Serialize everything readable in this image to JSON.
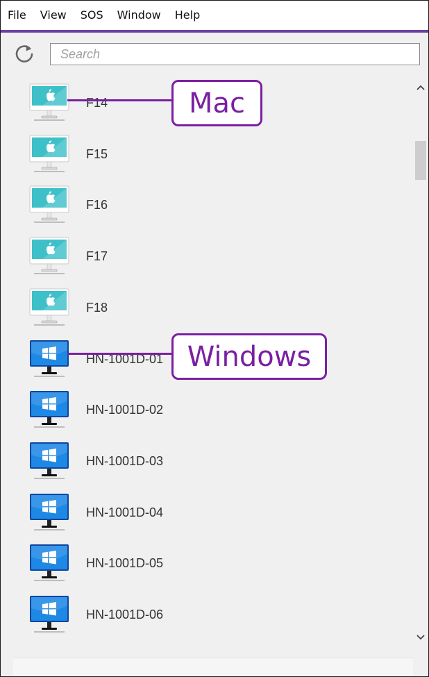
{
  "menu": {
    "items": [
      "File",
      "View",
      "SOS",
      "Window",
      "Help"
    ]
  },
  "toolbar": {
    "refresh_icon": "refresh-icon",
    "search_placeholder": "Search",
    "search_value": ""
  },
  "colors": {
    "accent": "#6b3fa0",
    "callout": "#7b1fa2",
    "mac_screen": "#3ec0c8",
    "windows_screen": "#1e88e5"
  },
  "computers": [
    {
      "name": "F14",
      "os": "mac",
      "icon": "mac-monitor-icon"
    },
    {
      "name": "F15",
      "os": "mac",
      "icon": "mac-monitor-icon"
    },
    {
      "name": "F16",
      "os": "mac",
      "icon": "mac-monitor-icon"
    },
    {
      "name": "F17",
      "os": "mac",
      "icon": "mac-monitor-icon"
    },
    {
      "name": "F18",
      "os": "mac",
      "icon": "mac-monitor-icon"
    },
    {
      "name": "HN-1001D-01",
      "os": "windows",
      "icon": "windows-monitor-icon"
    },
    {
      "name": "HN-1001D-02",
      "os": "windows",
      "icon": "windows-monitor-icon"
    },
    {
      "name": "HN-1001D-03",
      "os": "windows",
      "icon": "windows-monitor-icon"
    },
    {
      "name": "HN-1001D-04",
      "os": "windows",
      "icon": "windows-monitor-icon"
    },
    {
      "name": "HN-1001D-05",
      "os": "windows",
      "icon": "windows-monitor-icon"
    },
    {
      "name": "HN-1001D-06",
      "os": "windows",
      "icon": "windows-monitor-icon"
    }
  ],
  "callouts": {
    "mac": "Mac",
    "windows": "Windows"
  },
  "scrollbar": {
    "up_icon": "chevron-up-icon",
    "down_icon": "chevron-down-icon"
  }
}
